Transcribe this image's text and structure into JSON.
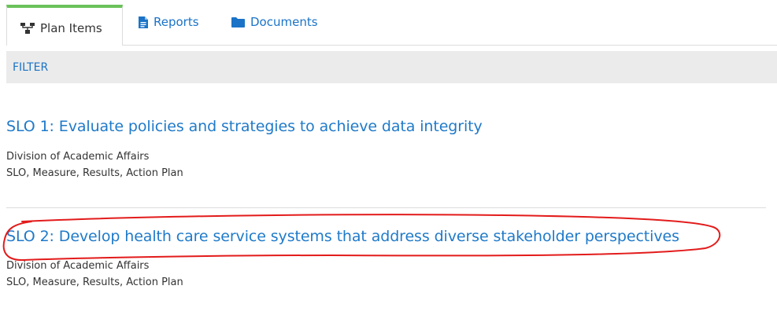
{
  "tabs": [
    {
      "label": "Plan Items",
      "icon": "sitemap-icon",
      "active": true
    },
    {
      "label": "Reports",
      "icon": "file-icon",
      "active": false
    },
    {
      "label": "Documents",
      "icon": "folder-icon",
      "active": false
    }
  ],
  "filter": {
    "label": "FILTER"
  },
  "items": [
    {
      "title": "SLO 1: Evaluate policies and strategies to achieve data integrity",
      "division": "Division of Academic Affairs",
      "components": "SLO, Measure, Results, Action Plan"
    },
    {
      "title": "SLO 2: Develop health care service systems that address diverse stakeholder perspectives",
      "division": "Division of Academic Affairs",
      "components": "SLO, Measure, Results, Action Plan"
    }
  ],
  "colors": {
    "link": "#1f7ac9",
    "active_tab_accent": "#6ac259",
    "filter_bar": "#ebebeb",
    "annotation": "#e31b1b"
  }
}
